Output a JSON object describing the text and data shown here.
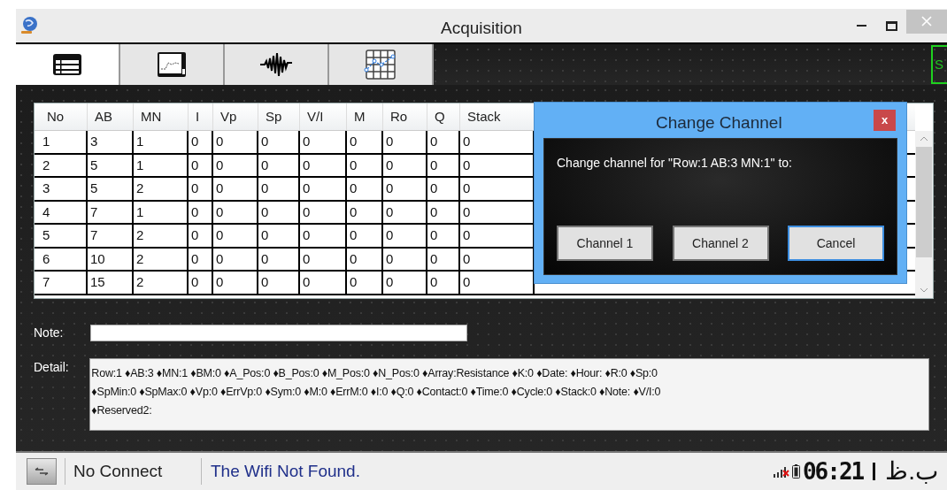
{
  "window": {
    "title": "Acquisition"
  },
  "tabs": [
    {
      "kind": "list",
      "selected": true
    },
    {
      "kind": "chart",
      "selected": false
    },
    {
      "kind": "wave",
      "selected": false
    },
    {
      "kind": "grid",
      "selected": false
    }
  ],
  "tab_strip_badge": "S",
  "table": {
    "columns": [
      "No",
      "AB",
      "MN",
      "I",
      "Vp",
      "Sp",
      "V/I",
      "M",
      "Ro",
      "Q",
      "Stack"
    ],
    "rows": [
      [
        "1",
        "3",
        "1",
        "0",
        "0",
        "0",
        "0",
        "0",
        "0",
        "0",
        "0"
      ],
      [
        "2",
        "5",
        "1",
        "0",
        "0",
        "0",
        "0",
        "0",
        "0",
        "0",
        "0"
      ],
      [
        "3",
        "5",
        "2",
        "0",
        "0",
        "0",
        "0",
        "0",
        "0",
        "0",
        "0"
      ],
      [
        "4",
        "7",
        "1",
        "0",
        "0",
        "0",
        "0",
        "0",
        "0",
        "0",
        "0"
      ],
      [
        "5",
        "7",
        "2",
        "0",
        "0",
        "0",
        "0",
        "0",
        "0",
        "0",
        "0"
      ],
      [
        "6",
        "10",
        "2",
        "0",
        "0",
        "0",
        "0",
        "0",
        "0",
        "0",
        "0"
      ],
      [
        "7",
        "15",
        "2",
        "0",
        "0",
        "0",
        "0",
        "0",
        "0",
        "0",
        "0"
      ]
    ]
  },
  "dialog": {
    "title": "Change Channel",
    "close": "x",
    "message": "Change channel for \"Row:1 AB:3 MN:1\" to:",
    "buttons": [
      {
        "label": "Channel 1",
        "focused": false
      },
      {
        "label": "Channel 2",
        "focused": false
      },
      {
        "label": "Cancel",
        "focused": true
      }
    ]
  },
  "note": {
    "label": "Note:"
  },
  "detail": {
    "label": "Detail:",
    "lines": [
      "Row:1 ♦AB:3 ♦MN:1 ♦BM:0 ♦A_Pos:0 ♦B_Pos:0 ♦M_Pos:0 ♦N_Pos:0 ♦Array:Resistance ♦K:0 ♦Date: ♦Hour: ♦R:0 ♦Sp:0",
      "♦SpMin:0 ♦SpMax:0 ♦Vp:0 ♦ErrVp:0 ♦Sym:0 ♦M:0 ♦ErrM:0 ♦I:0 ♦Q:0 ♦Contact:0 ♦Time:0 ♦Cycle:0 ♦Stack:0 ♦Note: ♦V/I:0",
      "♦Reserved2:"
    ]
  },
  "status_bar": {
    "connection": "No Connect",
    "wifi": "The Wifi Not Found.",
    "time": "06:21",
    "period": "ب.ظ"
  }
}
